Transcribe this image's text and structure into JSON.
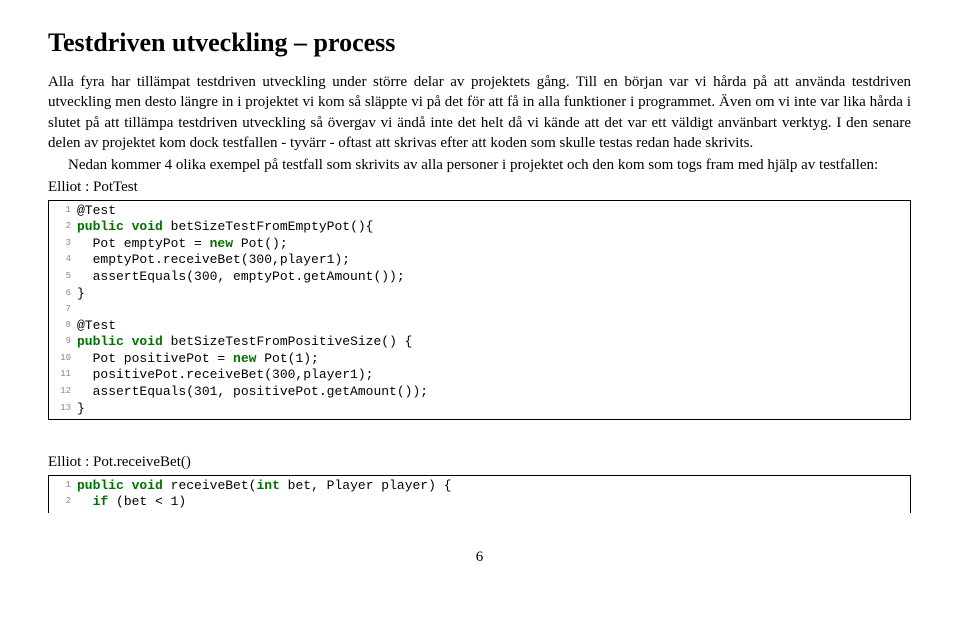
{
  "heading": "Testdriven utveckling – process",
  "para1": "Alla fyra har tillämpat testdriven utveckling under större delar av projektets gång. Till en början var vi hårda på att använda testdriven utveckling men desto längre in i projektet vi kom så släppte vi på det för att få in alla funktioner i programmet. Även om vi inte var lika hårda i slutet på att tillämpa testdriven utveckling så övergav vi ändå inte det helt då vi kände att det var ett väldigt använbart verktyg. I den senare delen av projektet kom dock testfallen - tyvärr - oftast att skrivas efter att koden som skulle testas redan hade skrivits.",
  "para2": "Nedan kommer 4 olika exempel på testfall som skrivits av alla personer i projektet och den kom som togs fram med hjälp av testfallen:",
  "elliot1": "Elliot : PotTest",
  "code1": [
    "@Test",
    "public void betSizeTestFromEmptyPot(){",
    "  Pot emptyPot = new Pot();",
    "  emptyPot.receiveBet(300,player1);",
    "  assertEquals(300, emptyPot.getAmount());",
    "}",
    "",
    "@Test",
    "public void betSizeTestFromPositiveSize() {",
    "  Pot positivePot = new Pot(1);",
    "  positivePot.receiveBet(300,player1);",
    "  assertEquals(301, positivePot.getAmount());",
    "}"
  ],
  "elliot2": "Elliot : Pot.receiveBet()",
  "code2": [
    "public void receiveBet(int bet, Player player) {",
    "  if (bet < 1)"
  ],
  "page_number": "6"
}
